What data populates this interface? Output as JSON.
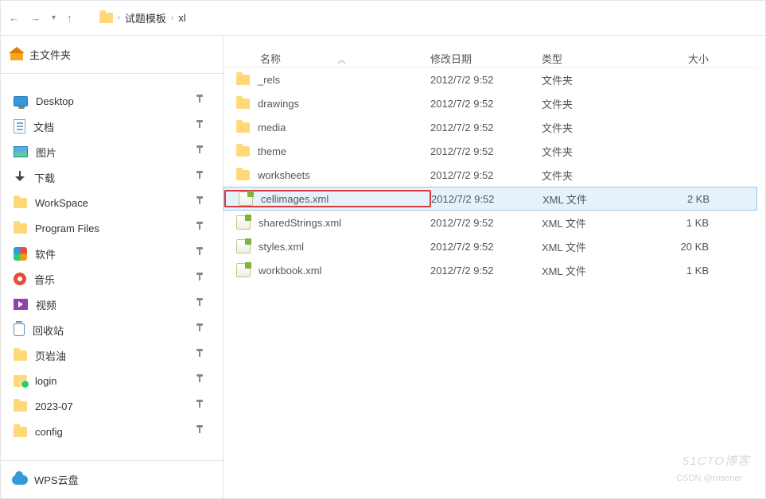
{
  "breadcrumb": {
    "folder1": "试题模板",
    "folder2": "xl"
  },
  "sidebar": {
    "header": "主文件夹",
    "items": [
      {
        "label": "Desktop",
        "icon": "icon-desktop"
      },
      {
        "label": "文档",
        "icon": "icon-doc"
      },
      {
        "label": "图片",
        "icon": "icon-pic"
      },
      {
        "label": "下载",
        "icon": "icon-down"
      },
      {
        "label": "WorkSpace",
        "icon": "icon-folder icon-folder-sm"
      },
      {
        "label": "Program Files",
        "icon": "icon-folder icon-folder-sm"
      },
      {
        "label": "软件",
        "icon": "icon-soft"
      },
      {
        "label": "音乐",
        "icon": "icon-music"
      },
      {
        "label": "视频",
        "icon": "icon-video"
      },
      {
        "label": "回收站",
        "icon": "icon-bin"
      },
      {
        "label": "页岩油",
        "icon": "icon-folder icon-folder-sm"
      },
      {
        "label": "login",
        "icon": "icon-login"
      },
      {
        "label": "2023-07",
        "icon": "icon-folder icon-folder-sm"
      },
      {
        "label": "config",
        "icon": "icon-folder icon-folder-sm"
      }
    ],
    "footer": "WPS云盘"
  },
  "columns": {
    "name": "名称",
    "date": "修改日期",
    "type": "类型",
    "size": "大小"
  },
  "types": {
    "folder": "文件夹",
    "xml": "XML 文件"
  },
  "files": [
    {
      "name": "_rels",
      "date": "2012/7/2 9:52",
      "type": "folder",
      "size": ""
    },
    {
      "name": "drawings",
      "date": "2012/7/2 9:52",
      "type": "folder",
      "size": ""
    },
    {
      "name": "media",
      "date": "2012/7/2 9:52",
      "type": "folder",
      "size": ""
    },
    {
      "name": "theme",
      "date": "2012/7/2 9:52",
      "type": "folder",
      "size": ""
    },
    {
      "name": "worksheets",
      "date": "2012/7/2 9:52",
      "type": "folder",
      "size": ""
    },
    {
      "name": "cellimages.xml",
      "date": "2012/7/2 9:52",
      "type": "xml",
      "size": "2 KB",
      "selected": true,
      "highlighted": true
    },
    {
      "name": "sharedStrings.xml",
      "date": "2012/7/2 9:52",
      "type": "xml",
      "size": "1 KB"
    },
    {
      "name": "styles.xml",
      "date": "2012/7/2 9:52",
      "type": "xml",
      "size": "20 KB"
    },
    {
      "name": "workbook.xml",
      "date": "2012/7/2 9:52",
      "type": "xml",
      "size": "1 KB"
    }
  ],
  "watermark": {
    "main": "51CTO博客",
    "sub": "CSDN @rosener"
  }
}
